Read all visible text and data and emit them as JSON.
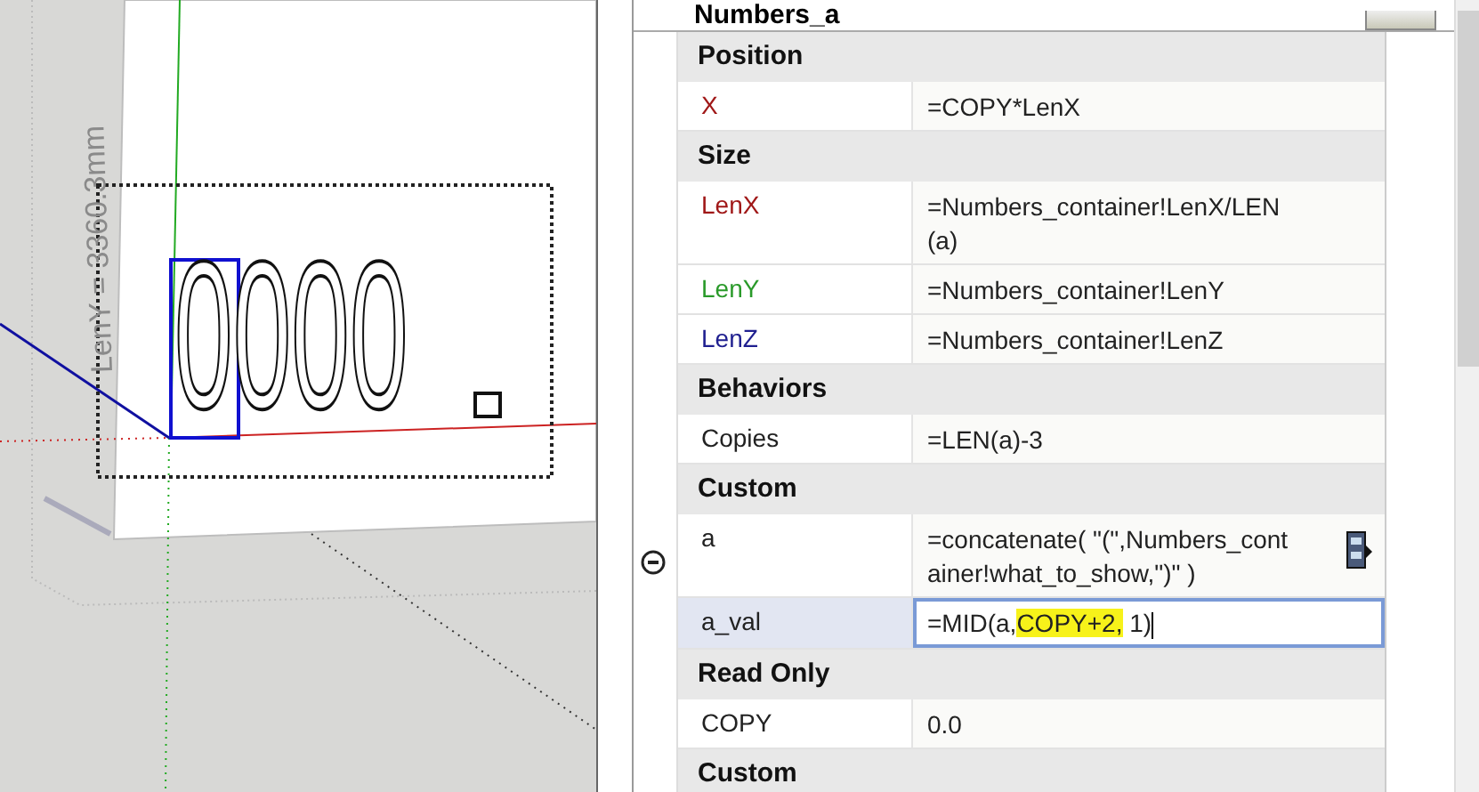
{
  "viewport": {
    "dimension_label": "LenY = 3360.3mm",
    "model_text": "0000"
  },
  "panel": {
    "title": "Numbers_a",
    "groups": [
      {
        "heading": "Position",
        "rows": [
          {
            "label": "X",
            "color": "#a01818",
            "value": "=COPY*LenX",
            "selected": false
          }
        ]
      },
      {
        "heading": "Size",
        "rows": [
          {
            "label": "LenX",
            "color": "#a01818",
            "value": "=Numbers_container!LenX/LEN(a)",
            "selected": false
          },
          {
            "label": "LenY",
            "color": "#2a9a2a",
            "value": "=Numbers_container!LenY",
            "selected": false
          },
          {
            "label": "LenZ",
            "color": "#202090",
            "value": "=Numbers_container!LenZ",
            "selected": false
          }
        ]
      },
      {
        "heading": "Behaviors",
        "rows": [
          {
            "label": "Copies",
            "color": "#222222",
            "value": "=LEN(a)-3",
            "selected": false
          }
        ]
      },
      {
        "heading": "Custom",
        "rows": [
          {
            "label": "a",
            "color": "#222222",
            "value": "=concatenate( \"(\",Numbers_container!what_to_show,\")\" )",
            "selected": false
          },
          {
            "label": "a_val",
            "color": "#222222",
            "selected": true,
            "value_parts": [
              {
                "text": "=MID(a,",
                "highlighted": false
              },
              {
                "text": "COPY+2,",
                "highlighted": true
              },
              {
                "text": " 1)",
                "highlighted": false
              }
            ]
          }
        ]
      },
      {
        "heading": "Read Only",
        "rows": [
          {
            "label": "COPY",
            "color": "#222222",
            "value": "0.0",
            "selected": false
          }
        ]
      },
      {
        "heading": "Custom"
      }
    ]
  }
}
